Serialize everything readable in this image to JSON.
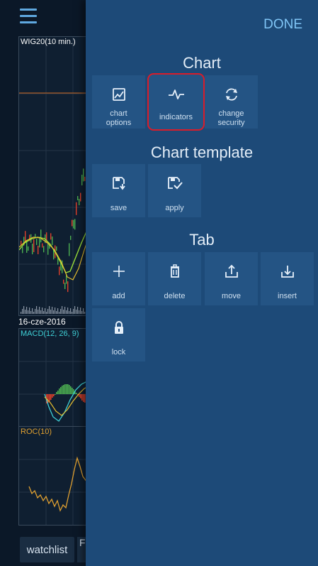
{
  "chart_strip": {
    "price_pane_label": "WIG20(10 min.)",
    "date_label": "16-cze-2016",
    "macd_label": "MACD(12, 26, 9)",
    "roc_label": "ROC(10)",
    "bottom_tab": "watchlist",
    "next_tab_partial": "F"
  },
  "panel": {
    "done_label": "DONE",
    "sections": {
      "chart": {
        "title": "Chart",
        "tiles": [
          {
            "label_line1": "chart",
            "label_line2": "options",
            "icon": "chart-options-icon"
          },
          {
            "label_line1": "indicators",
            "label_line2": "",
            "icon": "pulse-icon"
          },
          {
            "label_line1": "change",
            "label_line2": "security",
            "icon": "refresh-icon"
          }
        ]
      },
      "template": {
        "title": "Chart template",
        "tiles": [
          {
            "label": "save",
            "icon": "save-icon"
          },
          {
            "label": "apply",
            "icon": "apply-icon"
          }
        ]
      },
      "tab": {
        "title": "Tab",
        "tiles": [
          {
            "label": "add",
            "icon": "plus-icon"
          },
          {
            "label": "delete",
            "icon": "trash-icon"
          },
          {
            "label": "move",
            "icon": "upload-icon"
          },
          {
            "label": "insert",
            "icon": "download-icon"
          },
          {
            "label": "lock",
            "icon": "lock-icon"
          }
        ]
      }
    }
  },
  "colors": {
    "panel_bg": "#1d4a78",
    "tile_bg": "#245484",
    "done": "#7fc4f5",
    "highlight": "#d91c2a",
    "macd_label": "#3fd0d6",
    "roc_label": "#e0a030"
  }
}
